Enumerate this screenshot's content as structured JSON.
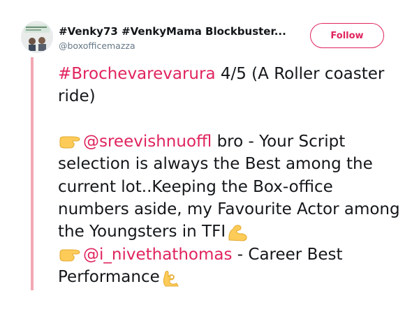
{
  "user": {
    "display_name": "#Venky73 #VenkyMama Blockbuster...",
    "handle": "@boxofficemazza"
  },
  "follow_button": {
    "label": "Follow"
  },
  "tweet": {
    "hashtag": "#Brochevarevarura",
    "line1_rest": " 4/5 (A Roller coaster ride)",
    "mention1": "@sreevishnuoffl",
    "para2_text": " bro - Your Script selection is always the Best among the current lot..Keeping the Box-office numbers aside, my Favourite Actor among the Youngsters in TFI",
    "mention2": "@i_nivethathomas",
    "para3_text": " - Career Best Performance"
  },
  "icons": {
    "pointing": "backhand-index-pointing-right-icon",
    "muscle": "flexed-biceps-icon",
    "ok": "ok-hand-icon"
  },
  "colors": {
    "accent": "#e0245e",
    "thread_line": "#f4a7b4",
    "handle_gray": "#657786",
    "emoji_yellow": "#fdcb58"
  }
}
